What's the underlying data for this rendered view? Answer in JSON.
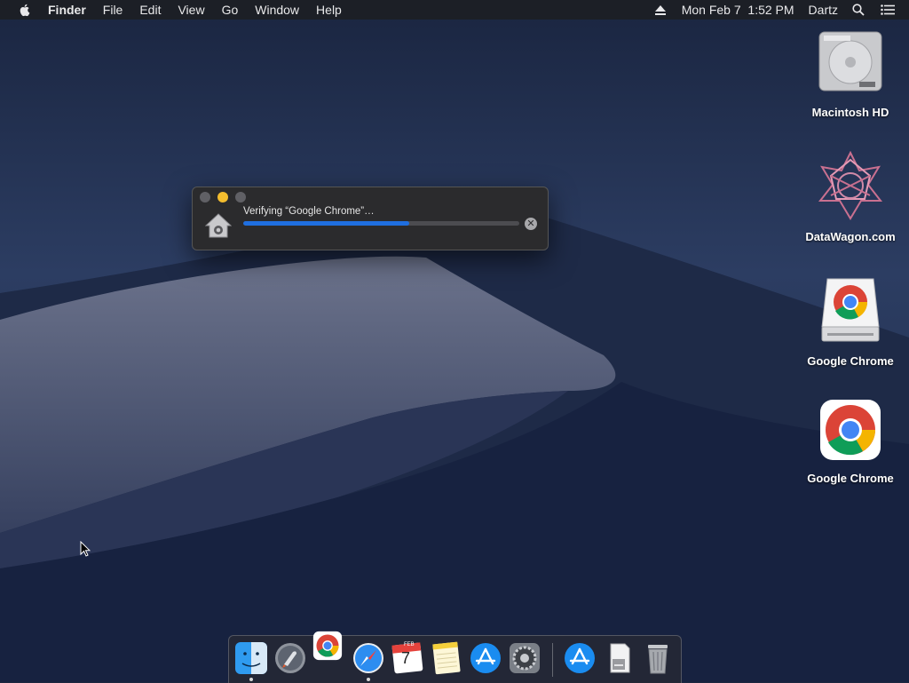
{
  "menubar": {
    "app_name": "Finder",
    "menus": [
      "File",
      "Edit",
      "View",
      "Go",
      "Window",
      "Help"
    ],
    "datetime": "Mon Feb 7  1:52 PM",
    "user": "Dartz",
    "icons": [
      "apple-icon",
      "eject-icon",
      "search-icon",
      "list-icon"
    ]
  },
  "desktop_icons": [
    {
      "label": "Macintosh HD",
      "icon": "hard-drive-icon"
    },
    {
      "label": "DataWagon.com",
      "icon": "datawagon-icon"
    },
    {
      "label": "Google Chrome",
      "icon": "chrome-disk-icon"
    },
    {
      "label": "Google Chrome",
      "icon": "chrome-icon"
    }
  ],
  "dialog": {
    "title": "Verifying “Google Chrome”…",
    "progress": 0.6,
    "icon": "installer-house-icon",
    "cancel_icon": "cancel-icon"
  },
  "dock": {
    "items": [
      "Finder",
      "Launchpad",
      "Google Chrome",
      "Safari",
      "Calendar",
      "Notes",
      "App Store",
      "System Preferences",
      "App Store",
      "Downloads",
      "Trash"
    ],
    "calendar": {
      "month": "FEB",
      "day": "7"
    }
  },
  "colors": {
    "accent": "#1f6fe0",
    "menubar": "#1c1e24",
    "dialog_bg": "#2b2b2d"
  }
}
